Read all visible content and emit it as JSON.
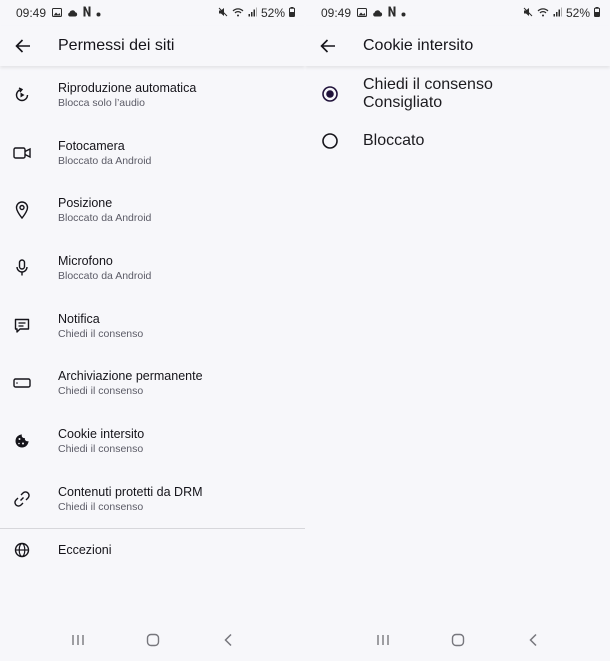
{
  "status_left": {
    "time": "09:49",
    "battery": "52%"
  },
  "status_right": {
    "time": "09:49",
    "battery": "52%"
  },
  "left_screen": {
    "title": "Permessi dei siti",
    "items": [
      {
        "label": "Riproduzione automatica",
        "sub": "Blocca solo l’audio",
        "icon": "autoplay-icon"
      },
      {
        "label": "Fotocamera",
        "sub": "Bloccato da Android",
        "icon": "camera-icon"
      },
      {
        "label": "Posizione",
        "sub": "Bloccato da Android",
        "icon": "location-icon"
      },
      {
        "label": "Microfono",
        "sub": "Bloccato da Android",
        "icon": "microphone-icon"
      },
      {
        "label": "Notifica",
        "sub": "Chiedi il consenso",
        "icon": "notification-icon"
      },
      {
        "label": "Archiviazione permanente",
        "sub": "Chiedi il consenso",
        "icon": "storage-icon"
      },
      {
        "label": "Cookie intersito",
        "sub": "Chiedi il consenso",
        "icon": "cookie-icon"
      },
      {
        "label": "Contenuti protetti da DRM",
        "sub": "Chiedi il consenso",
        "icon": "drm-icon"
      }
    ],
    "exceptions": "Eccezioni"
  },
  "right_screen": {
    "title": "Cookie intersito",
    "options": [
      {
        "label": "Chiedi il consenso",
        "sub": "Consigliato",
        "selected": true
      },
      {
        "label": "Bloccato",
        "sub": "",
        "selected": false
      }
    ]
  },
  "colors": {
    "background": "#f7f7fa",
    "text": "#15141a",
    "secondary": "#5b5b66",
    "radio": "#20123a"
  }
}
